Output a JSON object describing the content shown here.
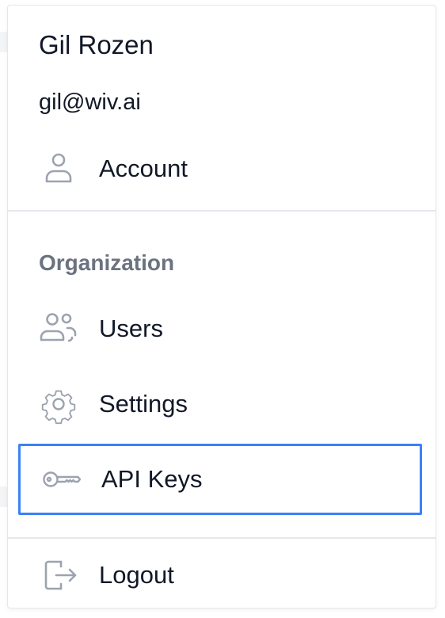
{
  "user": {
    "name": "Gil Rozen",
    "email": "gil@wiv.ai"
  },
  "menu": {
    "account": {
      "label": "Account",
      "icon": "user-icon"
    },
    "organization_heading": "Organization",
    "users": {
      "label": "Users",
      "icon": "users-icon"
    },
    "settings": {
      "label": "Settings",
      "icon": "gear-icon"
    },
    "api_keys": {
      "label": "API Keys",
      "icon": "key-icon",
      "focused": true
    },
    "logout": {
      "label": "Logout",
      "icon": "logout-icon"
    }
  },
  "colors": {
    "text": "#111827",
    "muted": "#6b7280",
    "icon": "#9ca3af",
    "border": "#e5e7eb",
    "focus": "#3b82f6"
  }
}
